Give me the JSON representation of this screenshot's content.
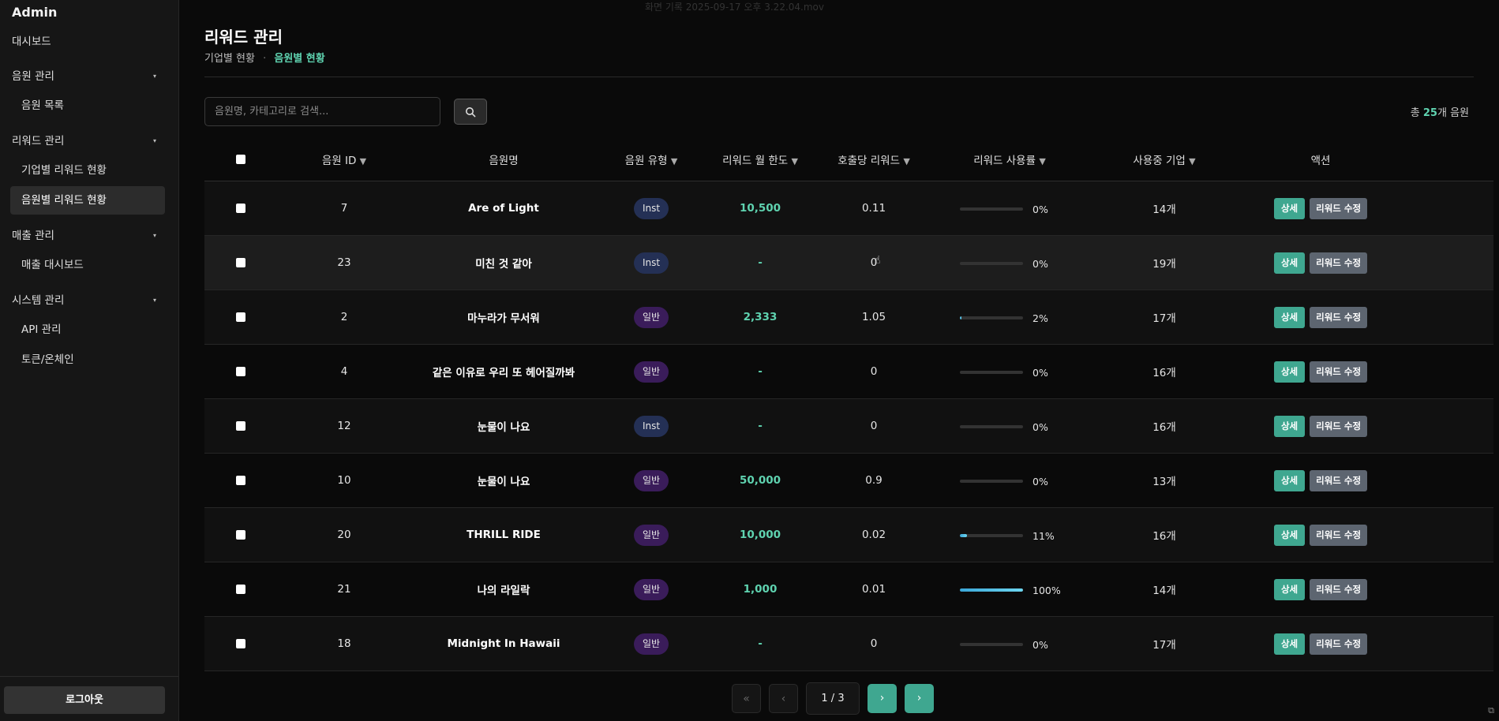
{
  "sidebar": {
    "brand": "Admin",
    "dashboard": "대시보드",
    "groups": [
      {
        "label": "음원 관리",
        "caret": "▾",
        "items": [
          "음원 목록"
        ]
      },
      {
        "label": "리워드 관리",
        "caret": "▾",
        "items": [
          "기업별 리워드 현황",
          "음원별 리워드 현황"
        ]
      },
      {
        "label": "매출 관리",
        "caret": "▾",
        "items": [
          "매출 대시보드"
        ]
      },
      {
        "label": "시스템 관리",
        "caret": "▾",
        "items": [
          "API 관리",
          "토큰/온체인"
        ]
      }
    ],
    "active_item": "음원별 리워드 현황",
    "logout": "로그아웃"
  },
  "window": {
    "file_label": "화면 기록 2025-09-17 오후 3.22.04.mov"
  },
  "header": {
    "title": "리워드 관리",
    "breadcrumb_1": "기업별 현황",
    "breadcrumb_sep": "·",
    "breadcrumb_2": "음원별 현황"
  },
  "search": {
    "placeholder": "음원명, 카테고리로 검색..."
  },
  "summary": {
    "prefix": "총 ",
    "count": "25",
    "suffix": "개 음원"
  },
  "table": {
    "columns": [
      {
        "label": "",
        "sortable": false
      },
      {
        "label": "음원 ID",
        "sortable": true
      },
      {
        "label": "음원명",
        "sortable": false
      },
      {
        "label": "음원 유형",
        "sortable": true
      },
      {
        "label": "리워드 월 한도",
        "sortable": true
      },
      {
        "label": "호출당 리워드",
        "sortable": true
      },
      {
        "label": "리워드 사용률",
        "sortable": true
      },
      {
        "label": "사용중 기업",
        "sortable": true
      },
      {
        "label": "액션",
        "sortable": false
      }
    ],
    "sort_icon": "▼",
    "detail_label": "상세",
    "edit_label": "리워드 수정",
    "rows": [
      {
        "id": "7",
        "name": "Are of Light",
        "type": "Inst",
        "limit": "10,500",
        "per_call": "0.11",
        "usage_pct": 0,
        "usage_label": "0%",
        "companies": "14개"
      },
      {
        "id": "23",
        "name": "미친 것 같아",
        "type": "Inst",
        "limit": "-",
        "per_call": "0",
        "usage_pct": 0,
        "usage_label": "0%",
        "companies": "19개"
      },
      {
        "id": "2",
        "name": "마누라가 무서워",
        "type": "일반",
        "limit": "2,333",
        "per_call": "1.05",
        "usage_pct": 2,
        "usage_label": "2%",
        "companies": "17개"
      },
      {
        "id": "4",
        "name": "같은 이유로 우리 또 헤어질까봐",
        "type": "일반",
        "limit": "-",
        "per_call": "0",
        "usage_pct": 0,
        "usage_label": "0%",
        "companies": "16개"
      },
      {
        "id": "12",
        "name": "눈물이 나요",
        "type": "Inst",
        "limit": "-",
        "per_call": "0",
        "usage_pct": 0,
        "usage_label": "0%",
        "companies": "16개"
      },
      {
        "id": "10",
        "name": "눈물이 나요",
        "type": "일반",
        "limit": "50,000",
        "per_call": "0.9",
        "usage_pct": 0,
        "usage_label": "0%",
        "companies": "13개"
      },
      {
        "id": "20",
        "name": "THRILL RIDE",
        "type": "일반",
        "limit": "10,000",
        "per_call": "0.02",
        "usage_pct": 11,
        "usage_label": "11%",
        "companies": "16개"
      },
      {
        "id": "21",
        "name": "나의 라일락",
        "type": "일반",
        "limit": "1,000",
        "per_call": "0.01",
        "usage_pct": 100,
        "usage_label": "100%",
        "companies": "14개"
      },
      {
        "id": "18",
        "name": "Midnight In Hawaii",
        "type": "일반",
        "limit": "-",
        "per_call": "0",
        "usage_pct": 0,
        "usage_label": "0%",
        "companies": "17개"
      }
    ]
  },
  "pagination": {
    "first": "«",
    "prev": "‹",
    "current": "1 / 3",
    "next": "›",
    "last": "›"
  },
  "colors": {
    "accent": "#5fd3b0",
    "detail_button": "#3fa790",
    "edit_button": "#5d6570",
    "inst_badge": "#243055",
    "general_badge": "#3a1c5a"
  }
}
